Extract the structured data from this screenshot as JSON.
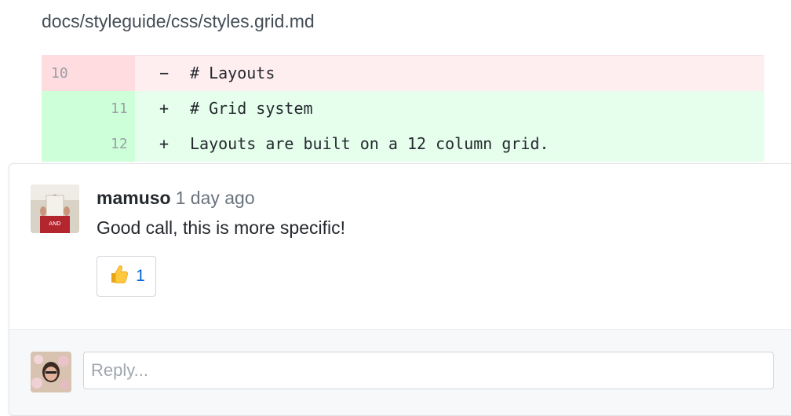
{
  "file": {
    "path": "docs/styleguide/css/styles.grid.md"
  },
  "diff": {
    "rows": [
      {
        "type": "del",
        "old_num": "10",
        "new_num": "",
        "sign": "−",
        "code": "# Layouts"
      },
      {
        "type": "add",
        "old_num": "",
        "new_num": "11",
        "sign": "+",
        "code": "# Grid system"
      },
      {
        "type": "add",
        "old_num": "",
        "new_num": "12",
        "sign": "+",
        "code": "Layouts are built on a 12 column grid."
      }
    ]
  },
  "comment": {
    "author": "mamuso",
    "time": "1 day ago",
    "body": "Good call, this is more specific!",
    "reaction": {
      "icon": "thumbs-up-icon",
      "count": "1"
    }
  },
  "reply": {
    "placeholder": "Reply..."
  },
  "colors": {
    "deletion_bg": "#ffeef0",
    "addition_bg": "#e6ffed",
    "link_blue": "#0366d6"
  }
}
